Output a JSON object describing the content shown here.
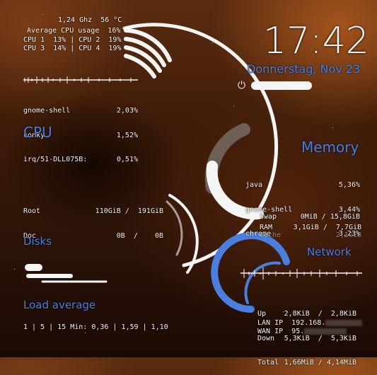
{
  "cpu": {
    "header": "1,24 Ghz  56 °C",
    "average_label": "Average CPU usage  16%",
    "cores_row1": "CPU 1  13% | CPU 2  19%",
    "cores_row2": "CPU 3  14% | CPU 4  19%",
    "processes": [
      {
        "name": "gnome-shell",
        "value": "2,03%"
      },
      {
        "name": "conky",
        "value": "1,52%"
      },
      {
        "name": "irq/51-DLL075B:",
        "value": "0,51%"
      }
    ],
    "title": "CPU"
  },
  "clock": {
    "time": "17:42",
    "date": "Donnerstag, Nov 23",
    "battery_percent": 100
  },
  "memory": {
    "title": "Memory",
    "processes": [
      {
        "name": "java",
        "value": "5,36%"
      },
      {
        "name": "gnome-shell",
        "value": "3,44%"
      },
      {
        "name": "chrome",
        "value": "3,23%"
      }
    ],
    "swap_label": "Swap",
    "swap_value": "0MiB / 15,8GiB",
    "ram_label": "RAM",
    "ram_value": "3,1GiB /  7,7GiB",
    "cache_label": "Cache",
    "cache_value": "2,1GiB"
  },
  "disks": {
    "title": "Disks",
    "rows": [
      {
        "name": "Root",
        "value": "110GiB /  191GiB"
      },
      {
        "name": "Doc",
        "value": "0B  /    0B"
      }
    ]
  },
  "load": {
    "title": "Load average",
    "text": "1 | 5 | 15 Min: 0,36 | 1,59 | 1,10"
  },
  "network": {
    "title": "Network",
    "up_label": "Up",
    "up_value": "2,8KiB  /  2,8KiB",
    "down_label": "Down",
    "down_value": "5,3KiB  /  5,3KiB",
    "total_label": "Total",
    "total_value": "1,66MiB / 4,14MiB",
    "lan_label": "LAN IP",
    "lan_value": "192.168.",
    "wan_label": "WAN IP",
    "wan_value": "95."
  },
  "colors": {
    "accent": "#4a7fe0",
    "text": "#f2f2f2",
    "ring": "#f5f5f5"
  }
}
